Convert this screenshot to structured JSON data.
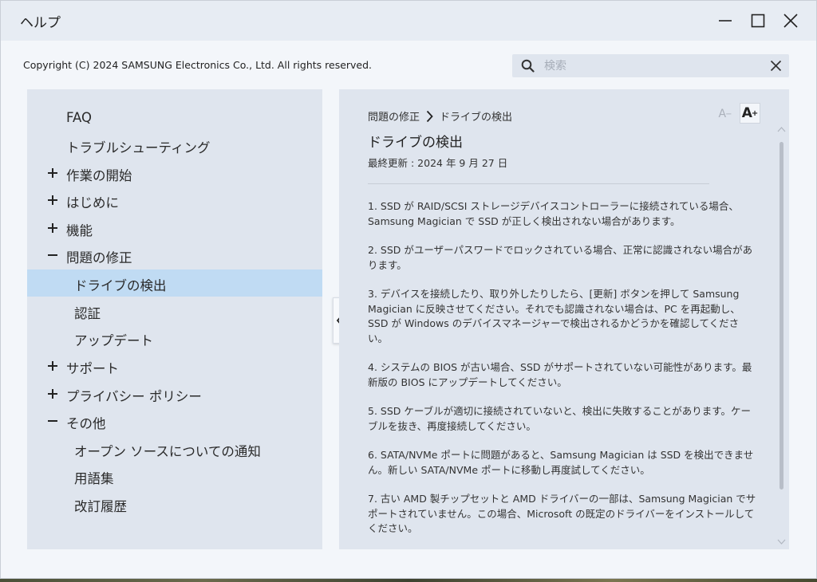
{
  "window": {
    "title": "ヘルプ"
  },
  "header": {
    "copyright": "Copyright (C) 2024 SAMSUNG Electronics Co., Ltd. All rights reserved.",
    "search": {
      "placeholder": "検索",
      "value": ""
    }
  },
  "sidebar": {
    "items": [
      {
        "label": "FAQ",
        "sign": "",
        "level": 0
      },
      {
        "label": "トラブルシューティング",
        "sign": "",
        "level": 0
      },
      {
        "label": "作業の開始",
        "sign": "+",
        "level": 0
      },
      {
        "label": "はじめに",
        "sign": "+",
        "level": 0
      },
      {
        "label": "機能",
        "sign": "+",
        "level": 0
      },
      {
        "label": "問題の修正",
        "sign": "−",
        "level": 0
      },
      {
        "label": "ドライブの検出",
        "sign": "",
        "level": 1,
        "active": true
      },
      {
        "label": "認証",
        "sign": "",
        "level": 1
      },
      {
        "label": "アップデート",
        "sign": "",
        "level": 1
      },
      {
        "label": "サポート",
        "sign": "+",
        "level": 0
      },
      {
        "label": "プライバシー ポリシー",
        "sign": "+",
        "level": 0
      },
      {
        "label": "その他",
        "sign": "−",
        "level": 0
      },
      {
        "label": "オープン ソースについての通知",
        "sign": "",
        "level": 1
      },
      {
        "label": "用語集",
        "sign": "",
        "level": 1
      },
      {
        "label": "改訂履歴",
        "sign": "",
        "level": 1
      }
    ]
  },
  "content": {
    "breadcrumb": [
      "問題の修正",
      "ドライブの検出"
    ],
    "font_small_label": "A",
    "font_small_sup": "−",
    "font_large_label": "A",
    "font_large_sup": "+",
    "title": "ドライブの検出",
    "updated": "最終更新 : 2024 年 9 月 27 日",
    "paragraphs": [
      "1. SSD が RAID/SCSI ストレージデバイスコントローラーに接続されている場合、Samsung Magician で SSD が正しく検出されない場合があります。",
      "2. SSD がユーザーパスワードでロックされている場合、正常に認識されない場合があります。",
      "3. デバイスを接続したり、取り外したりしたら、[更新] ボタンを押して Samsung Magician に反映させてください。それでも認識されない場合は、PC を再起動し、SSD が Windows のデバイスマネージャーで検出されるかどうかを確認してください。",
      "4. システムの BIOS が古い場合、SSD がサポートされていない可能性があります。最新版の BIOS にアップデートしてください。",
      "5. SSD ケーブルが適切に接続されていないと、検出に失敗することがあります。ケーブルを抜き、再度接続してください。",
      "6. SATA/NVMe ポートに問題があると、Samsung Magician は SSD を検出できません。新しい SATA/NVMe ポートに移動し再度試してください。",
      "7. 古い AMD 製チップセットと AMD ドライバーの一部は、Samsung Magician でサポートされていません。この場合、Microsoft の既定のドライバーをインストールしてください。"
    ]
  },
  "icons": {
    "minimize": "minimize-icon",
    "maximize": "maximize-icon",
    "close": "close-icon",
    "search": "search-icon",
    "clear": "clear-icon",
    "collapse": "chevron-left-icon"
  },
  "colors": {
    "active_item": "#c0dbf3",
    "panel": "#dfe5ee",
    "titlebar": "#e7ecf3"
  }
}
